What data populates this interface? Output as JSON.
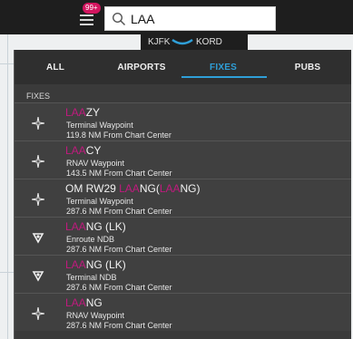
{
  "header": {
    "notification_badge": "99+",
    "search": {
      "value": "LAA",
      "placeholder": ""
    }
  },
  "route": {
    "from": "KJFK",
    "to": "KORD"
  },
  "tabs": [
    {
      "label": "ALL"
    },
    {
      "label": "AIRPORTS"
    },
    {
      "label": "FIXES",
      "active": true
    },
    {
      "label": "PUBS"
    }
  ],
  "section_label": "FIXES",
  "results": [
    {
      "match": "LAA",
      "pre": "",
      "suffix": "ZY",
      "post": "",
      "type": "Terminal Waypoint",
      "distance": "119.8 NM From Chart Center",
      "icon": "waypoint-star-icon"
    },
    {
      "match": "LAA",
      "pre": "",
      "suffix": "CY",
      "post": "",
      "type": "RNAV Waypoint",
      "distance": "143.5 NM From Chart Center",
      "icon": "waypoint-star-icon"
    },
    {
      "match": "LAA",
      "pre": "OM RW29 ",
      "suffix": "NG(",
      "match2": "LAA",
      "post": "NG)",
      "type": "Terminal Waypoint",
      "distance": "287.6 NM From Chart Center",
      "icon": "waypoint-star-icon"
    },
    {
      "match": "LAA",
      "pre": "",
      "suffix": "NG (LK)",
      "post": "",
      "type": "Enroute NDB",
      "distance": "287.6 NM From Chart Center",
      "icon": "ndb-icon"
    },
    {
      "match": "LAA",
      "pre": "",
      "suffix": "NG (LK)",
      "post": "",
      "type": "Terminal NDB",
      "distance": "287.6 NM From Chart Center",
      "icon": "ndb-icon"
    },
    {
      "match": "LAA",
      "pre": "",
      "suffix": "NG",
      "post": "",
      "type": "RNAV Waypoint",
      "distance": "287.6 NM From Chart Center",
      "icon": "waypoint-star-icon"
    }
  ],
  "colors": {
    "accent": "#2f9fd8",
    "match_highlight": "#c01a7e",
    "badge": "#d3155f"
  }
}
